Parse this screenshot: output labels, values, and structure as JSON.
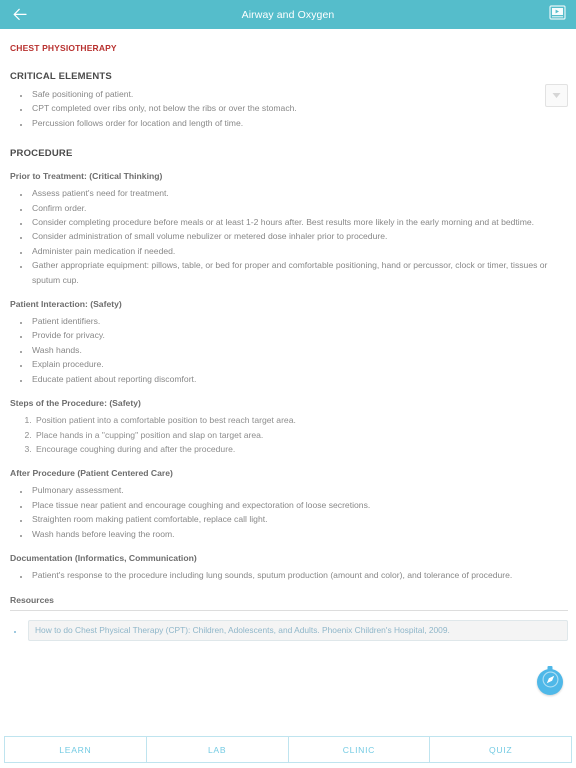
{
  "appbar": {
    "title": "Airway and Oxygen",
    "back_icon": "arrow-left-icon",
    "media_icon": "video-slideshow-icon",
    "bg_color": "#55bdcb"
  },
  "document": {
    "title": "CHEST PHYSIOTHERAPY",
    "title_color": "#b8312f",
    "collapse_icon": "chevron-down-icon",
    "sections": [
      {
        "heading": "CRITICAL ELEMENTS",
        "items": [
          "Safe positioning of patient.",
          "CPT completed over ribs only, not below the ribs or over the stomach.",
          "Percussion follows order for location and length of time."
        ]
      }
    ],
    "procedure_heading": "PROCEDURE",
    "subsections": [
      {
        "subheading": "Prior to Treatment: (Critical Thinking)",
        "list_type": "bullet",
        "items": [
          "Assess patient's need for treatment.",
          "Confirm order.",
          "Consider completing procedure before meals or at least 1-2 hours after. Best results more likely in the early morning and at bedtime.",
          "Consider administration of small volume nebulizer or metered dose inhaler prior to procedure.",
          "Administer pain medication if needed.",
          "Gather appropriate equipment: pillows, table, or bed for proper and comfortable positioning, hand or percussor, clock or timer, tissues or sputum cup."
        ]
      },
      {
        "subheading": "Patient Interaction: (Safety)",
        "list_type": "bullet",
        "items": [
          "Patient identifiers.",
          "Provide for privacy.",
          "Wash hands.",
          "Explain procedure.",
          "Educate patient about reporting discomfort."
        ]
      },
      {
        "subheading": "Steps of the Procedure: (Safety)",
        "list_type": "number",
        "items": [
          "Position patient into a comfortable position to best reach target area.",
          "Place hands in a \"cupping\" position and slap on target area.",
          "Encourage coughing during and after the procedure."
        ]
      },
      {
        "subheading": "After Procedure (Patient Centered Care)",
        "list_type": "bullet",
        "items": [
          "Pulmonary assessment.",
          "Place tissue near patient and encourage coughing and expectoration of loose secretions.",
          "Straighten room making patient comfortable, replace call light.",
          "Wash hands before leaving the room."
        ]
      },
      {
        "subheading": "Documentation (Informatics, Communication)",
        "list_type": "bullet",
        "items": [
          "Patient's response to the procedure including lung sounds, sputum production (amount and color), and tolerance of procedure."
        ]
      }
    ],
    "resources": {
      "heading": "Resources",
      "links": [
        "How to do Chest Physical Therapy (CPT): Children, Adolescents, and Adults. Phoenix Children's Hospital, 2009."
      ]
    }
  },
  "fab": {
    "icon": "compass-navigate-icon",
    "color": "#4fb8e8"
  },
  "tabbar": {
    "tabs": [
      {
        "label": "LEARN"
      },
      {
        "label": "LAB"
      },
      {
        "label": "CLINIC"
      },
      {
        "label": "QUIZ"
      }
    ],
    "text_color": "#74cbe3",
    "border_color": "#bfe4ef"
  }
}
